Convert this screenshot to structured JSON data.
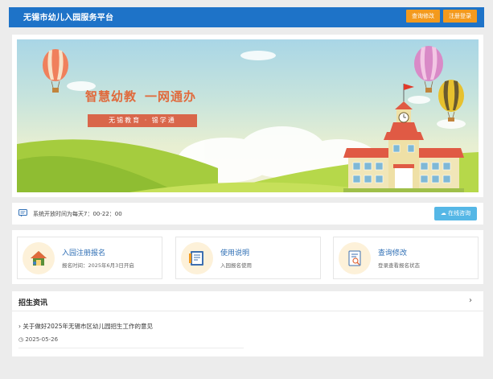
{
  "header": {
    "title": "无锡市幼儿入园服务平台",
    "query_btn": "查询修改",
    "register_btn": "注册登录"
  },
  "banner": {
    "slogan_left": "智慧幼教",
    "slogan_right": "一网通办",
    "sub_slogan": "无锡教育 · 锡学通"
  },
  "notice": {
    "text": "系统开放时间为每天7：00-22：00",
    "consult_btn": "在线咨询"
  },
  "cards": [
    {
      "title": "入园注册报名",
      "sub": "报名时间：2025年6月3日开启",
      "icon": "house-icon"
    },
    {
      "title": "使用说明",
      "sub": "入园报名使用",
      "icon": "document-icon"
    },
    {
      "title": "查询修改",
      "sub": "登录查看报名状态",
      "icon": "search-doc-icon"
    }
  ],
  "news": {
    "heading": "招生资讯",
    "more": "›",
    "items": [
      {
        "title": "关于做好2025年无锡市区幼儿园招生工作的意见",
        "date": "2025-05-26"
      }
    ]
  },
  "colors": {
    "header_blue": "#1e73c8",
    "button_orange": "#f39a1e",
    "consult_blue": "#55b7e6",
    "slogan_red": "#e06a3c"
  }
}
